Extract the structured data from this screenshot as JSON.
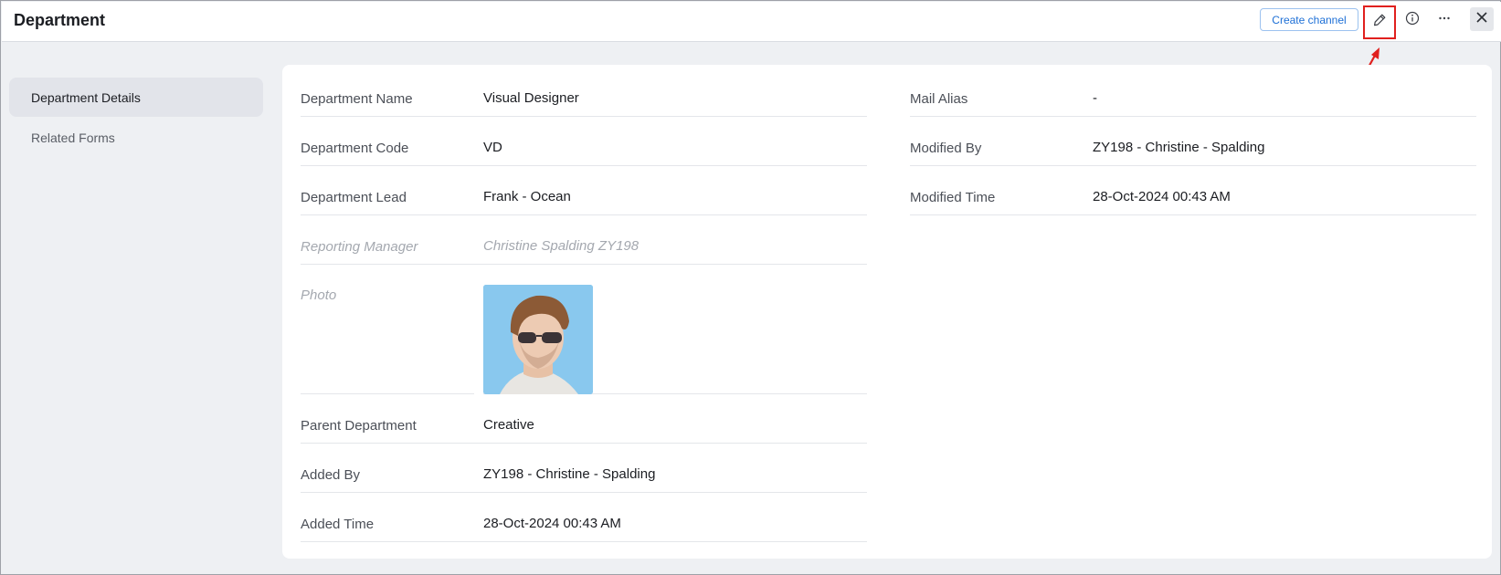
{
  "header": {
    "title": "Department",
    "create_channel_label": "Create channel",
    "icons": [
      "edit-icon",
      "info-icon",
      "more-icon",
      "close-icon"
    ]
  },
  "sidebar": {
    "items": [
      {
        "label": "Department Details",
        "active": true
      },
      {
        "label": "Related Forms",
        "active": false
      }
    ]
  },
  "details_left": [
    {
      "label": "Department Name",
      "value": "Visual Designer"
    },
    {
      "label": "Department Code",
      "value": "VD"
    },
    {
      "label": "Department Lead",
      "value": "Frank - Ocean"
    },
    {
      "label": "Reporting Manager",
      "value": "Christine Spalding ZY198"
    },
    {
      "label": "Photo",
      "value": ""
    },
    {
      "label": "Parent Department",
      "value": "Creative"
    },
    {
      "label": "Added By",
      "value": "ZY198 - Christine - Spalding"
    },
    {
      "label": "Added Time",
      "value": "28-Oct-2024 00:43 AM"
    }
  ],
  "details_right": [
    {
      "label": "Mail Alias",
      "value": "-"
    },
    {
      "label": "Modified By",
      "value": "ZY198 - Christine - Spalding"
    },
    {
      "label": "Modified Time",
      "value": "28-Oct-2024 00:43 AM"
    }
  ],
  "colors": {
    "accent": "#1d6fd6",
    "annotation": "#e0201e",
    "photo_background": "#89c8ee"
  }
}
